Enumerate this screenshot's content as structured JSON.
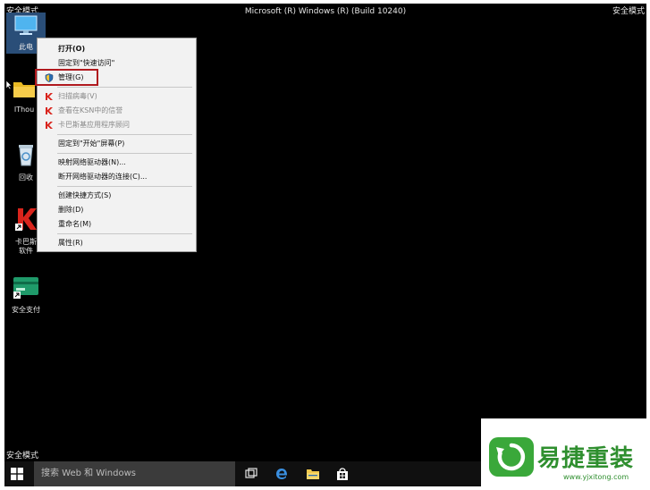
{
  "desktop": {
    "safe_mode_label": "安全模式",
    "os_title": "Microsoft (R) Windows (R) (Build 10240)",
    "icons": [
      {
        "label": "此电",
        "icon": "computer-icon"
      },
      {
        "label": "IThou",
        "icon": "folder-icon"
      },
      {
        "label": "回收",
        "icon": "recycle-bin-icon"
      },
      {
        "label": "卡巴斯",
        "label2": "软件",
        "icon": "kaspersky-icon"
      },
      {
        "label": "安全支付",
        "icon": "safe-payment-icon"
      }
    ]
  },
  "context_menu": {
    "items": [
      {
        "label": "打开(O)",
        "bold": true
      },
      {
        "label": "固定到\"快速访问\""
      },
      {
        "label": "管理(G)",
        "icon": "shield-icon"
      },
      {
        "label": "扫描病毒(V)",
        "icon": "kaspersky-k-icon",
        "disabled": true
      },
      {
        "label": "查看在KSN中的信誉",
        "icon": "kaspersky-k-icon",
        "disabled": true
      },
      {
        "label": "卡巴斯基应用程序顾问",
        "icon": "kaspersky-k-icon",
        "disabled": true
      },
      {
        "label": "固定到\"开始\"屏幕(P)"
      },
      {
        "label": "映射网络驱动器(N)..."
      },
      {
        "label": "断开网络驱动器的连接(C)..."
      },
      {
        "label": "创建快捷方式(S)"
      },
      {
        "label": "删除(D)"
      },
      {
        "label": "重命名(M)"
      },
      {
        "label": "属性(R)"
      }
    ]
  },
  "taskbar": {
    "search_placeholder": "搜索 Web 和 Windows",
    "icons": [
      "task-view-icon",
      "edge-icon",
      "file-explorer-icon",
      "store-icon"
    ]
  },
  "watermark": {
    "brand": "易捷重装",
    "url": "www.yjxitong.com",
    "color": "#2f8f2f"
  },
  "colors": {
    "desktop_bg": "#000000",
    "highlight_box": "#b0191e"
  }
}
